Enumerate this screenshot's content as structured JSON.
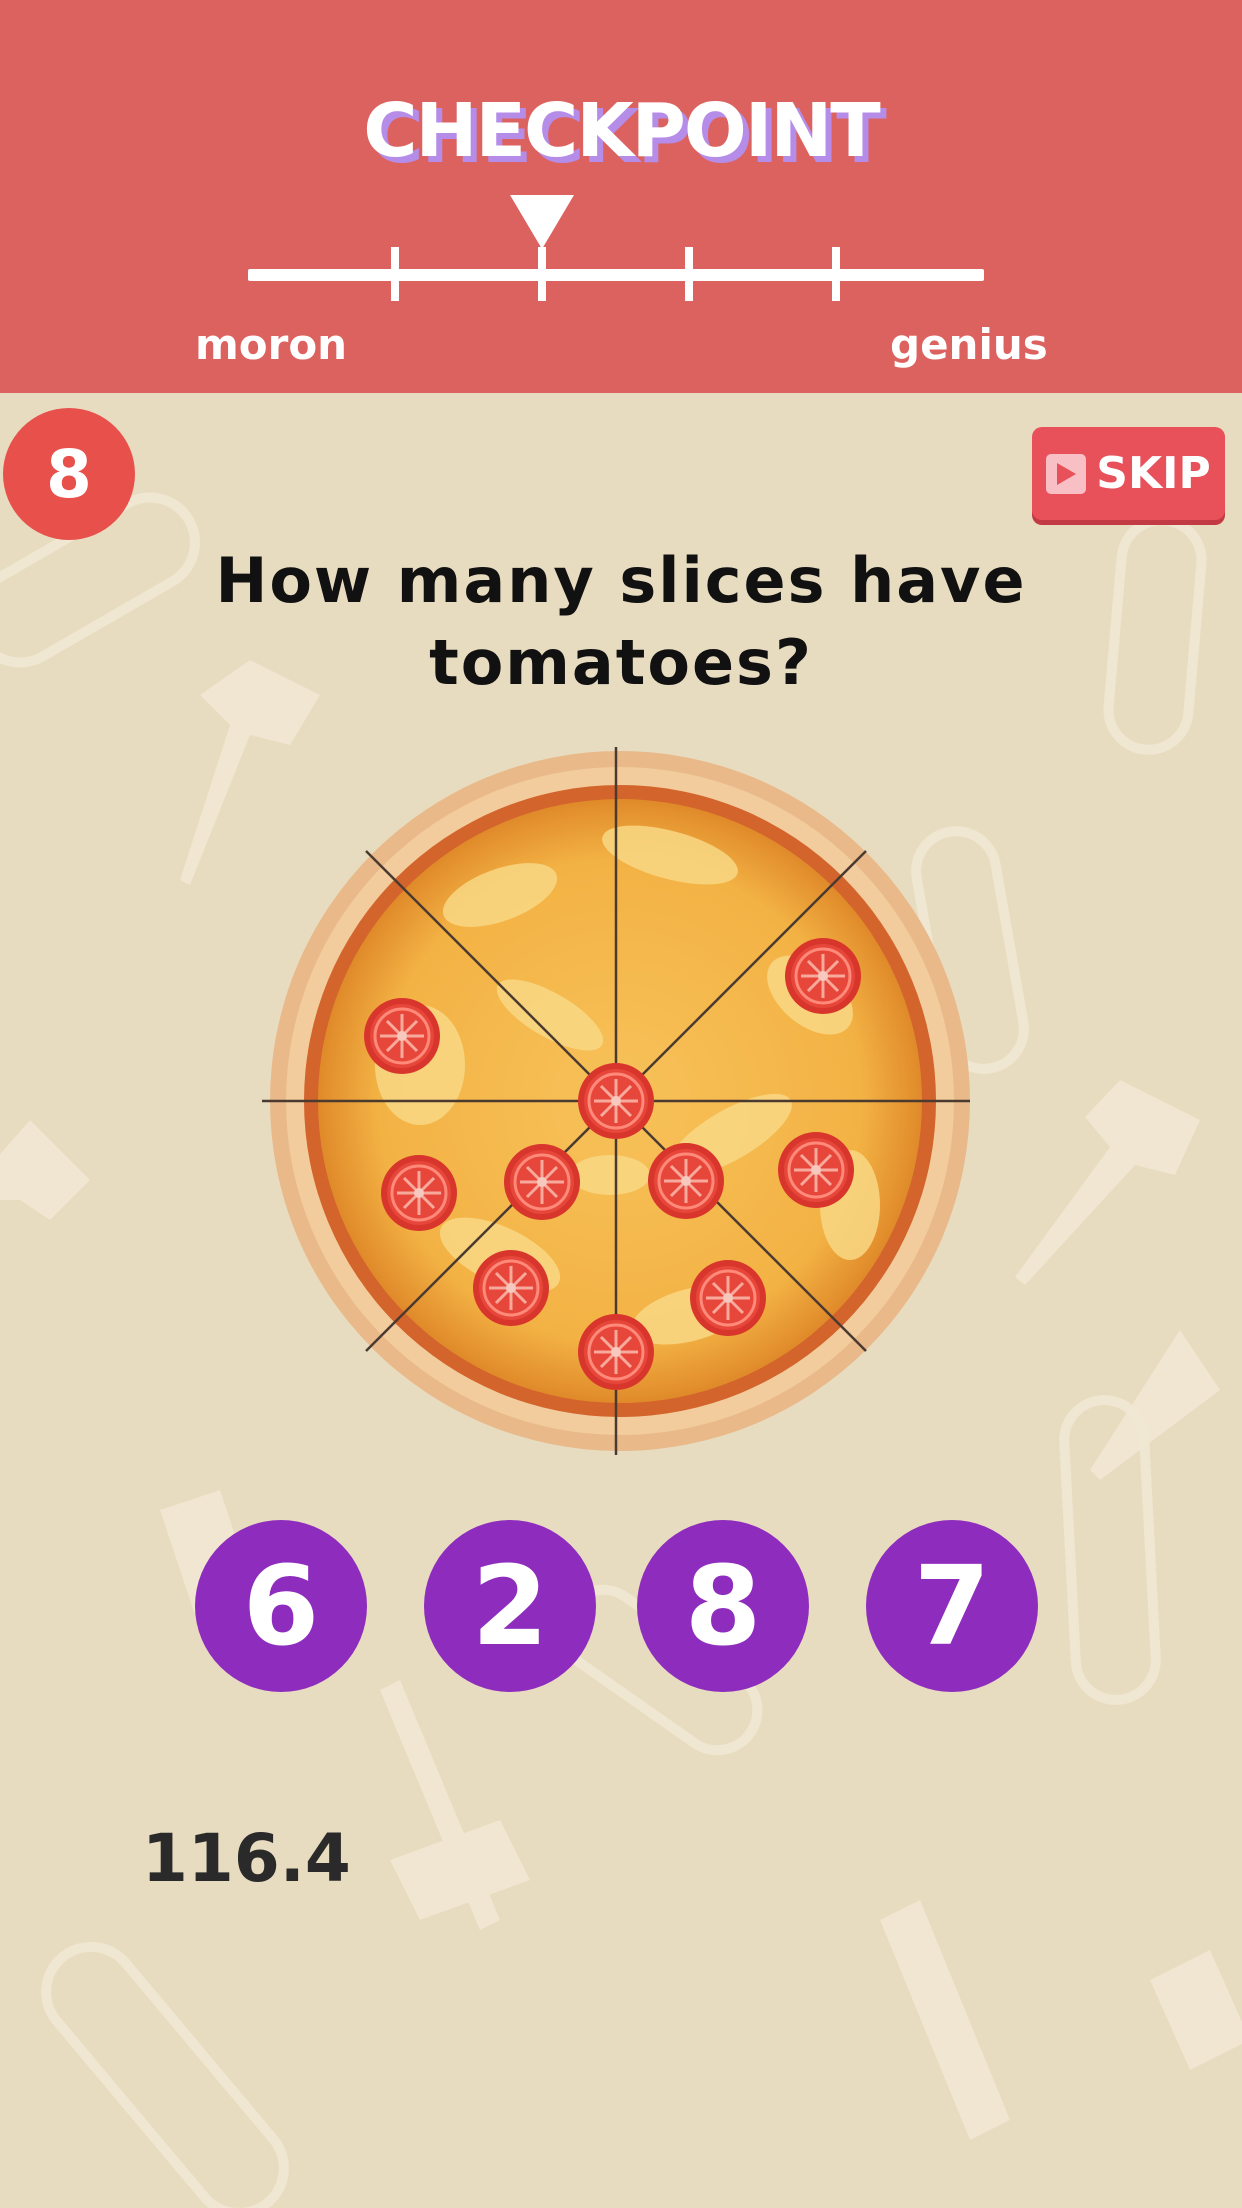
{
  "header": {
    "title": "CHECKPOINT",
    "meter": {
      "left_label": "moron",
      "right_label": "genius",
      "tick_count": 4,
      "pointer_tick": 2
    }
  },
  "level": "8",
  "skip": {
    "label": "SKIP",
    "icon": "play-icon"
  },
  "question": {
    "line1": "How many slices have",
    "line2": "tomatoes?"
  },
  "pizza": {
    "slices": 8,
    "topping": "tomato-slice-icon"
  },
  "answers": [
    "6",
    "2",
    "8",
    "7"
  ],
  "timer": "116.4",
  "colors": {
    "header": "#dc6260",
    "background": "#e8dcc0",
    "answer_button": "#8e2dbd",
    "skip_button": "#e8505a",
    "level_badge": "#e8504c"
  }
}
